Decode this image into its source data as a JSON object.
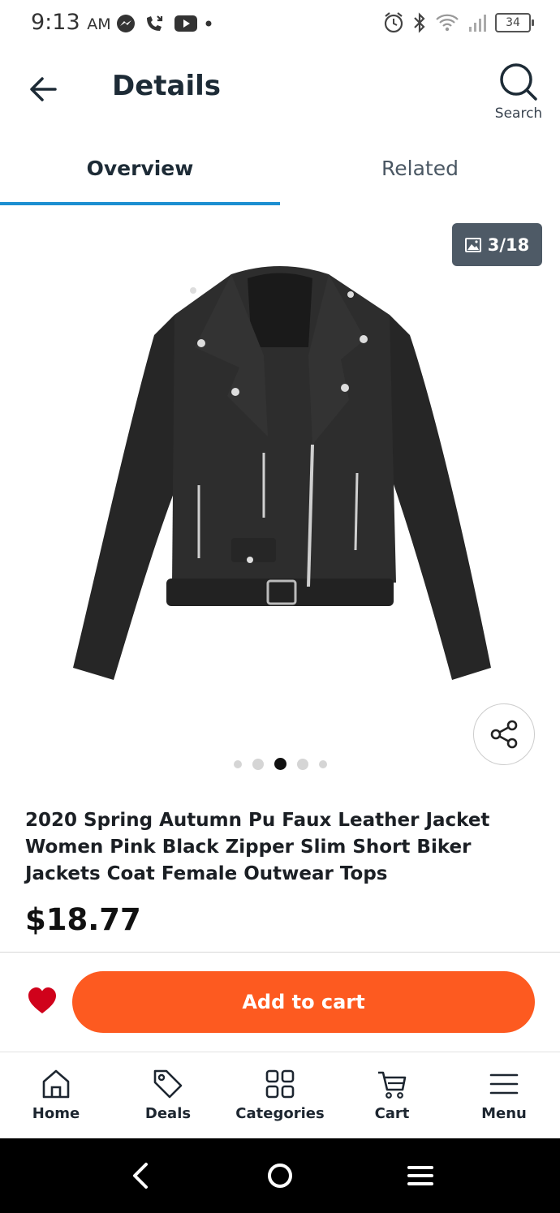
{
  "status_bar": {
    "time": "9:13",
    "ampm": "AM",
    "battery": "34"
  },
  "header": {
    "title": "Details",
    "search_label": "Search"
  },
  "tabs": [
    {
      "label": "Overview",
      "active": true
    },
    {
      "label": "Related",
      "active": false
    }
  ],
  "gallery": {
    "counter": "3/18",
    "current_index": 3,
    "dots_visible": 5
  },
  "product": {
    "title": "2020 Spring Autumn Pu Faux Leather Jacket Women Pink Black Zipper Slim Short Biker Jackets Coat Female Outwear Tops",
    "price": "$18.77"
  },
  "actions": {
    "add_to_cart_label": "Add to cart"
  },
  "bottom_nav": [
    {
      "label": "Home",
      "icon": "home-icon"
    },
    {
      "label": "Deals",
      "icon": "tag-icon"
    },
    {
      "label": "Categories",
      "icon": "grid-icon"
    },
    {
      "label": "Cart",
      "icon": "cart-icon"
    },
    {
      "label": "Menu",
      "icon": "menu-icon"
    }
  ],
  "colors": {
    "accent": "#1c8fd1",
    "cart_button": "#fd5a20",
    "favorite": "#d0021b",
    "counter_badge": "#4e5a66"
  }
}
